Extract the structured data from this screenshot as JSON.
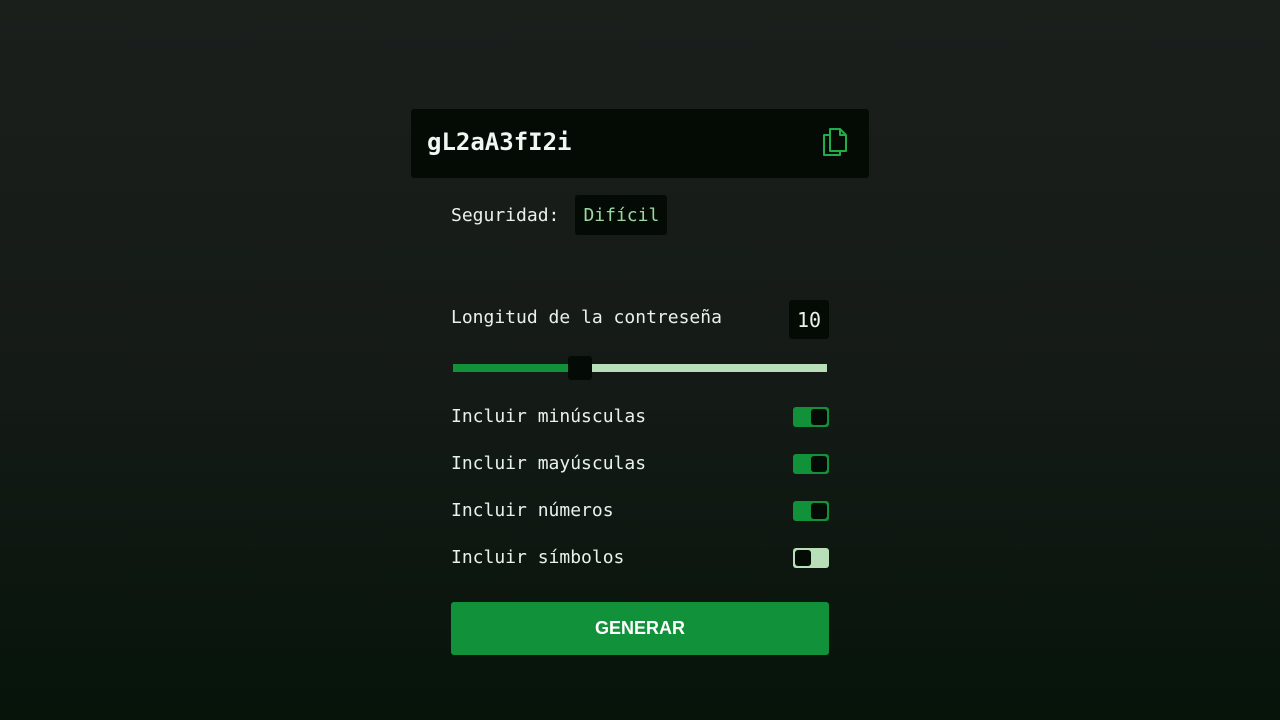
{
  "password": {
    "value": "gL2aA3fI2i",
    "copy_icon": "copy-icon"
  },
  "strength": {
    "label": "Seguridad:",
    "value": "Difícil"
  },
  "length": {
    "label": "Longitud de la contreseña",
    "value": "10",
    "slider_fraction": 0.34
  },
  "options": [
    {
      "label": "Incluir minúsculas",
      "enabled": true
    },
    {
      "label": "Incluir mayúsculas",
      "enabled": true
    },
    {
      "label": "Incluir números",
      "enabled": true
    },
    {
      "label": "Incluir símbolos",
      "enabled": false
    }
  ],
  "generate": {
    "label": "GENERAR"
  },
  "colors": {
    "accent": "#12913b",
    "track_light": "#b8dfb8",
    "panel": "#040b05",
    "badge_text": "#9fd7a3"
  }
}
